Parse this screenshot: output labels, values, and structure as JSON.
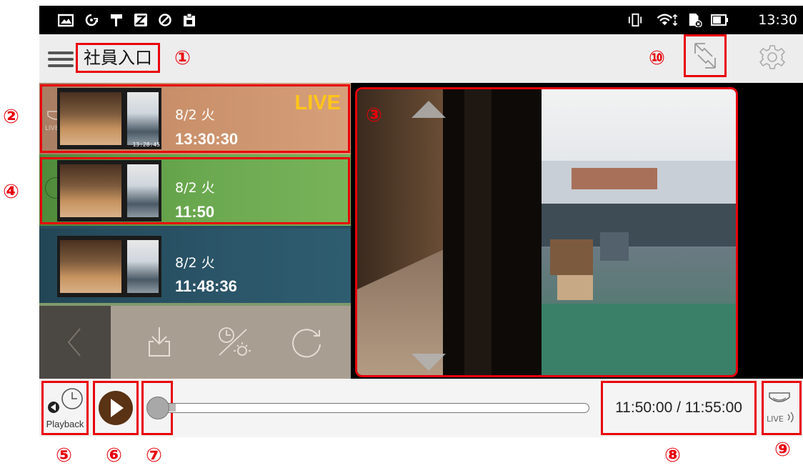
{
  "status_bar": {
    "time": "13:30",
    "left_icons": [
      "gallery-icon",
      "sync-icon",
      "paint-roller-icon",
      "z-app-icon",
      "block-icon",
      "clipboard-icon"
    ],
    "right_icons": [
      "vibrate-icon",
      "wifi-icon",
      "sd-card-icon",
      "battery-icon"
    ]
  },
  "app_bar": {
    "camera_name": "社員入口",
    "menu_icon": "hamburger-icon",
    "expand_icon": "expand-arrows-icon",
    "settings_icon": "gear-icon"
  },
  "callouts": {
    "c1": "①",
    "c2": "②",
    "c3": "③",
    "c4": "④",
    "c5": "⑤",
    "c6": "⑥",
    "c7": "⑦",
    "c8": "⑧",
    "c9": "⑨",
    "c10": "⑩"
  },
  "recordings": [
    {
      "date": "8/2 火",
      "time": "13:30:30",
      "badge": "LIVE",
      "overlay_time": "13:28:45",
      "overlay_label": "LIVE",
      "bg": "#c9906a"
    },
    {
      "date": "8/2 火",
      "time": "11:50",
      "bg": "#6aa84f"
    },
    {
      "date": "8/2 火",
      "time": "11:48:36",
      "bg": "#2b5569"
    }
  ],
  "toolbar": {
    "icons": [
      "back-icon",
      "download-icon",
      "timer-light-icon",
      "refresh-icon"
    ]
  },
  "playback": {
    "playback_label": "Playback",
    "current_time": "11:50:00",
    "total_time": "11:55:00",
    "time_display": "11:50:00 / 11:55:00",
    "progress_fraction": 0.04,
    "live_label": "LIVE"
  },
  "colors": {
    "callout_red": "#e8000b",
    "live_yellow": "#ffc51a",
    "play_brown": "#5a3214"
  }
}
